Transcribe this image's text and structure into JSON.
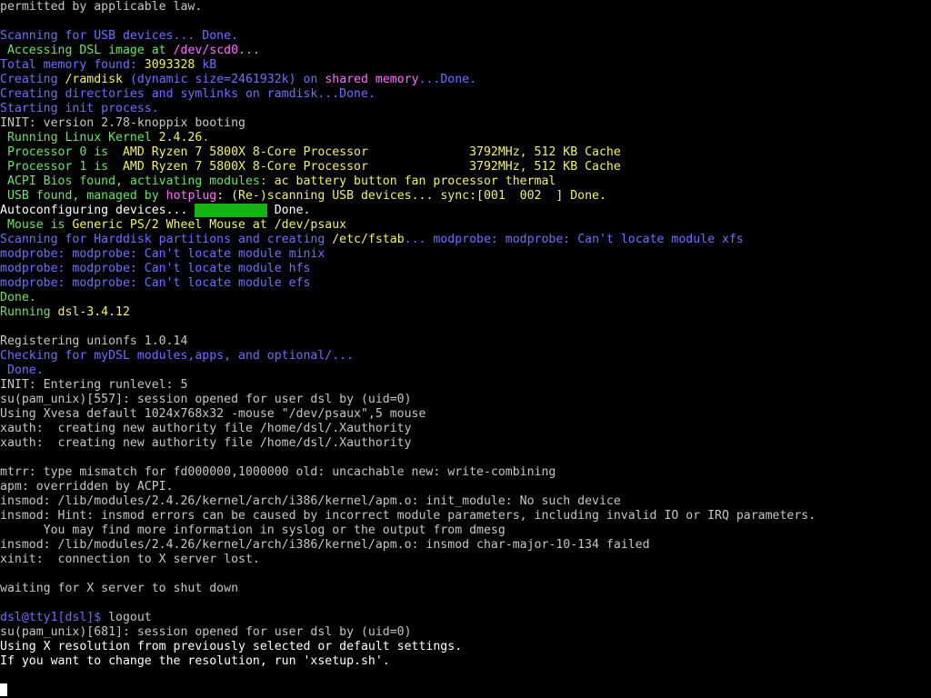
{
  "terminal": {
    "lines": [
      {
        "segments": [
          {
            "text": "permitted by applicable law.",
            "color": "grey"
          }
        ]
      },
      {
        "segments": []
      },
      {
        "segments": [
          {
            "text": "Scanning for USB devices... Done.",
            "color": "blue"
          }
        ]
      },
      {
        "segments": [
          {
            "text": " Accessing DSL image at ",
            "color": "green"
          },
          {
            "text": "/dev/scd0",
            "color": "magenta"
          },
          {
            "text": "...",
            "color": "green"
          }
        ]
      },
      {
        "segments": [
          {
            "text": "Total memory found: ",
            "color": "blue"
          },
          {
            "text": "3093328",
            "color": "yellow"
          },
          {
            "text": " kB",
            "color": "blue"
          }
        ]
      },
      {
        "segments": [
          {
            "text": "Creating ",
            "color": "blue"
          },
          {
            "text": "/ramdisk",
            "color": "yellow"
          },
          {
            "text": " (dynamic size=2461932k) on ",
            "color": "blue"
          },
          {
            "text": "shared memory",
            "color": "magenta"
          },
          {
            "text": "...Done.",
            "color": "blue"
          }
        ]
      },
      {
        "segments": [
          {
            "text": "Creating directories and symlinks on ramdisk...Done.",
            "color": "blue"
          }
        ]
      },
      {
        "segments": [
          {
            "text": "Starting init process.",
            "color": "blue"
          }
        ]
      },
      {
        "segments": [
          {
            "text": "INIT: version 2.78-knoppix booting",
            "color": "grey"
          }
        ]
      },
      {
        "segments": [
          {
            "text": " Running Linux Kernel ",
            "color": "green"
          },
          {
            "text": "2.4.26",
            "color": "yellow"
          },
          {
            "text": ".",
            "color": "green"
          }
        ]
      },
      {
        "segments": [
          {
            "text": " Processor 0 is  ",
            "color": "green"
          },
          {
            "text": "AMD Ryzen 7 5800X 8-Core Processor              3792MHz, 512 KB Cache",
            "color": "yellow"
          }
        ]
      },
      {
        "segments": [
          {
            "text": " Processor 1 is  ",
            "color": "green"
          },
          {
            "text": "AMD Ryzen 7 5800X 8-Core Processor              3792MHz, 512 KB Cache",
            "color": "yellow"
          }
        ]
      },
      {
        "segments": [
          {
            "text": " ACPI Bios found, activating modules: ",
            "color": "green"
          },
          {
            "text": "ac battery button fan processor thermal",
            "color": "yellow"
          }
        ]
      },
      {
        "segments": [
          {
            "text": " USB found, managed by ",
            "color": "green"
          },
          {
            "text": "hotplug",
            "color": "magenta"
          },
          {
            "text": ": (Re-)scanning USB devices... sync:[001  002  ] Done.",
            "color": "yellow"
          }
        ]
      },
      {
        "segments": [
          {
            "text": "Autoconfiguring devices... ",
            "color": "white"
          },
          {
            "text": "          ",
            "color": "block"
          },
          {
            "text": " Done.",
            "color": "white"
          }
        ]
      },
      {
        "segments": [
          {
            "text": " Mouse is ",
            "color": "green"
          },
          {
            "text": "Generic PS/2 Wheel Mouse at /dev/psaux",
            "color": "yellow"
          }
        ]
      },
      {
        "segments": [
          {
            "text": "Scanning for Harddisk partitions and creating ",
            "color": "blue"
          },
          {
            "text": "/etc/fstab",
            "color": "yellow"
          },
          {
            "text": "... modprobe: modprobe: Can't locate module xfs",
            "color": "blue"
          }
        ]
      },
      {
        "segments": [
          {
            "text": "modprobe: modprobe: Can't locate module minix",
            "color": "blue"
          }
        ]
      },
      {
        "segments": [
          {
            "text": "modprobe: modprobe: Can't locate module hfs",
            "color": "blue"
          }
        ]
      },
      {
        "segments": [
          {
            "text": "modprobe: modprobe: Can't locate module efs",
            "color": "blue"
          }
        ]
      },
      {
        "segments": [
          {
            "text": "Done.",
            "color": "green"
          }
        ]
      },
      {
        "segments": [
          {
            "text": "Running ",
            "color": "green"
          },
          {
            "text": "dsl-3.4.12",
            "color": "yellow"
          }
        ]
      },
      {
        "segments": []
      },
      {
        "segments": [
          {
            "text": "Registering unionfs 1.0.14",
            "color": "grey"
          }
        ]
      },
      {
        "segments": [
          {
            "text": "Checking for myDSL modules,apps, and optional/...",
            "color": "blue"
          }
        ]
      },
      {
        "segments": [
          {
            "text": " Done.",
            "color": "blue"
          }
        ]
      },
      {
        "segments": [
          {
            "text": "INIT: Entering runlevel: 5",
            "color": "grey"
          }
        ]
      },
      {
        "segments": [
          {
            "text": "su(pam_unix)[557]: session opened for user dsl by (uid=0)",
            "color": "grey"
          }
        ]
      },
      {
        "segments": [
          {
            "text": "Using Xvesa default 1024x768x32 -mouse \"/dev/psaux\",5 mouse",
            "color": "grey"
          }
        ]
      },
      {
        "segments": [
          {
            "text": "xauth:  creating new authority file /home/dsl/.Xauthority",
            "color": "grey"
          }
        ]
      },
      {
        "segments": [
          {
            "text": "xauth:  creating new authority file /home/dsl/.Xauthority",
            "color": "grey"
          }
        ]
      },
      {
        "segments": []
      },
      {
        "segments": [
          {
            "text": "mtrr: type mismatch for fd000000,1000000 old: uncachable new: write-combining",
            "color": "grey"
          }
        ]
      },
      {
        "segments": [
          {
            "text": "apm: overridden by ACPI.",
            "color": "grey"
          }
        ]
      },
      {
        "segments": [
          {
            "text": "insmod: /lib/modules/2.4.26/kernel/arch/i386/kernel/apm.o: init_module: No such device",
            "color": "grey"
          }
        ]
      },
      {
        "segments": [
          {
            "text": "insmod: Hint: insmod errors can be caused by incorrect module parameters, including invalid IO or IRQ parameters.",
            "color": "grey"
          }
        ]
      },
      {
        "segments": [
          {
            "text": "      You may find more information in syslog or the output from dmesg",
            "color": "grey"
          }
        ]
      },
      {
        "segments": [
          {
            "text": "insmod: /lib/modules/2.4.26/kernel/arch/i386/kernel/apm.o: insmod char-major-10-134 failed",
            "color": "grey"
          }
        ]
      },
      {
        "segments": [
          {
            "text": "xinit:  connection to X server lost.",
            "color": "grey"
          }
        ]
      },
      {
        "segments": []
      },
      {
        "segments": [
          {
            "text": "waiting for X server to shut down",
            "color": "grey"
          }
        ]
      },
      {
        "segments": []
      },
      {
        "segments": [
          {
            "text": "dsl@tty1[dsl]$",
            "color": "blue"
          },
          {
            "text": " logout",
            "color": "grey"
          }
        ]
      },
      {
        "segments": [
          {
            "text": "su(pam_unix)[681]: session opened for user dsl by (uid=0)",
            "color": "grey"
          }
        ]
      },
      {
        "segments": [
          {
            "text": "Using X resolution from previously selected or default settings.",
            "color": "white"
          }
        ]
      },
      {
        "segments": [
          {
            "text": "If you want to change the resolution, run 'xsetup.sh'.",
            "color": "white"
          }
        ]
      }
    ],
    "colors": {
      "grey": "#c6c6c6",
      "white": "#ffffff",
      "blue": "#6f6fff",
      "green": "#6be36b",
      "yellow": "#f2f26a",
      "magenta": "#ff6fff",
      "block": "#13b413"
    }
  }
}
